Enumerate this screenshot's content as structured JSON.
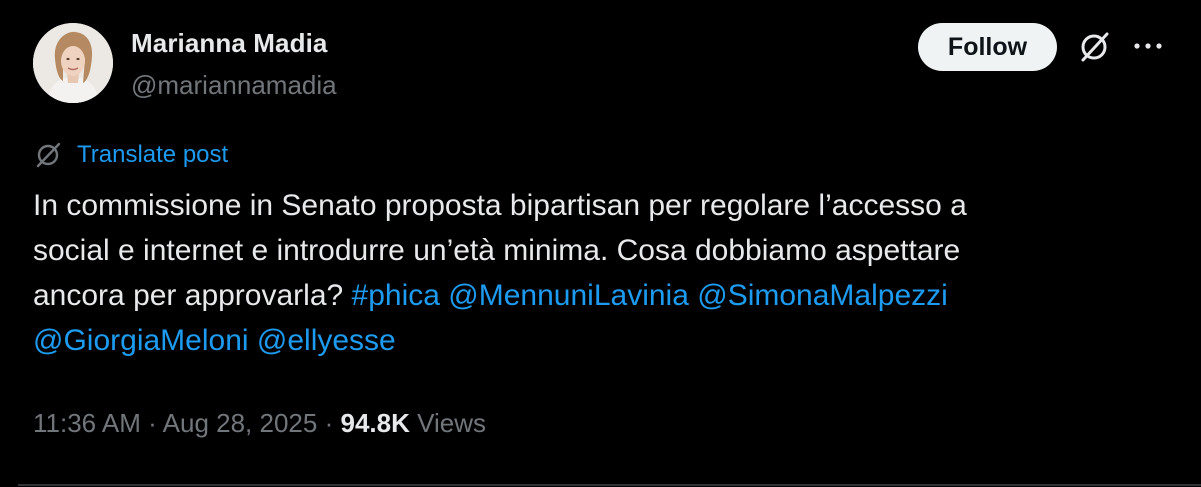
{
  "author": {
    "name": "Marianna Madia",
    "handle": "@mariannamadia"
  },
  "actions": {
    "follow_label": "Follow",
    "grok_icon": "grok-slash-circle-icon",
    "more_icon": "more-dots-icon"
  },
  "translate": {
    "label": "Translate post",
    "icon": "grok-slash-circle-icon"
  },
  "post": {
    "line1": "In commissione in Senato proposta bipartisan per regolare l’accesso a",
    "line2": "social e internet e introdurre un’età minima. Cosa dobbiamo aspettare",
    "line3_text": "ancora per approvarla?",
    "hashtag": "#phica",
    "mentions": [
      "@MennuniLavinia",
      "@SimonaMalpezzi",
      "@GiorgiaMeloni",
      "@ellyesse"
    ]
  },
  "meta": {
    "time": "11:36 AM",
    "separator": "·",
    "date": "Aug 28, 2025",
    "views_count": "94.8K",
    "views_label": "Views"
  },
  "colors": {
    "background": "#000000",
    "text": "#e7e9ea",
    "secondary": "#71767b",
    "link": "#1d9bf0",
    "button_bg": "#eff3f4"
  }
}
